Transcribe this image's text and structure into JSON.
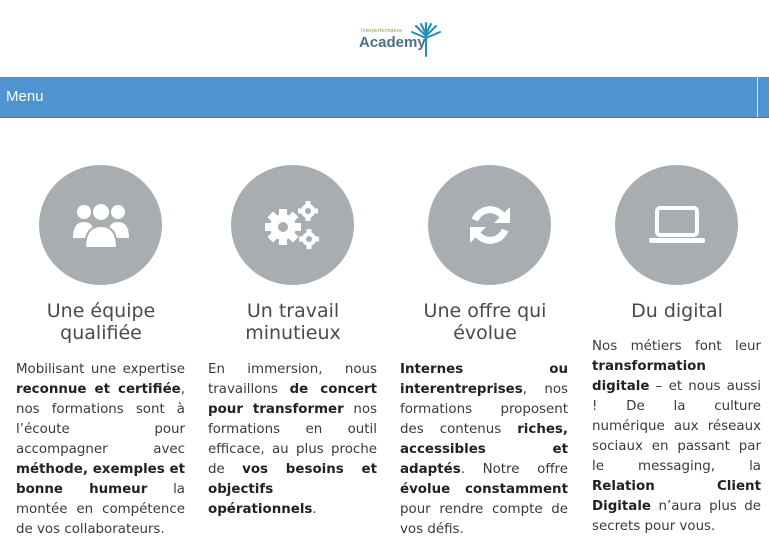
{
  "logo": {
    "small": "Interperformance",
    "main": "Academy"
  },
  "menu": {
    "label": "Menu"
  },
  "features": [
    {
      "title": "Une équipe qualifiée",
      "icon": "team-icon"
    },
    {
      "title": "Un travail minutieux",
      "icon": "gears-icon"
    },
    {
      "title": "Une offre qui évolue",
      "icon": "refresh-icon"
    },
    {
      "title": "Du digital",
      "icon": "laptop-icon"
    }
  ],
  "p1": {
    "a": "Mobilisant une expertise ",
    "b": "reconnue et certifiée",
    "c": ", nos formations sont à l’écoute pour accompagner avec ",
    "d": "méthode, exemples et bonne humeur",
    "e": " la montée en compétence de vos collaborateurs."
  },
  "p2": {
    "a": "En immersion, nous travaillons ",
    "b": "de concert pour transformer",
    "c": " nos formations en outil efficace, au plus proche de ",
    "d": "vos besoins et objectifs opérationnels",
    "e": "."
  },
  "p3": {
    "a": "Internes ou interentreprises",
    "b": ", nos formations proposent des contenus ",
    "c": "riches, accessibles et adaptés",
    "d": ". Notre offre ",
    "e": "évolue constamment",
    "f": " pour rendre compte de vos défis."
  },
  "p4": {
    "a": "Nos métiers font leur ",
    "b": "transformation digitale",
    "c": " – et nous aussi ! De la culture numérique aux réseaux sociaux en passant par le messaging, la ",
    "d": "Relation Client Digitale",
    "e": " n’aura plus de secrets pour vous."
  }
}
